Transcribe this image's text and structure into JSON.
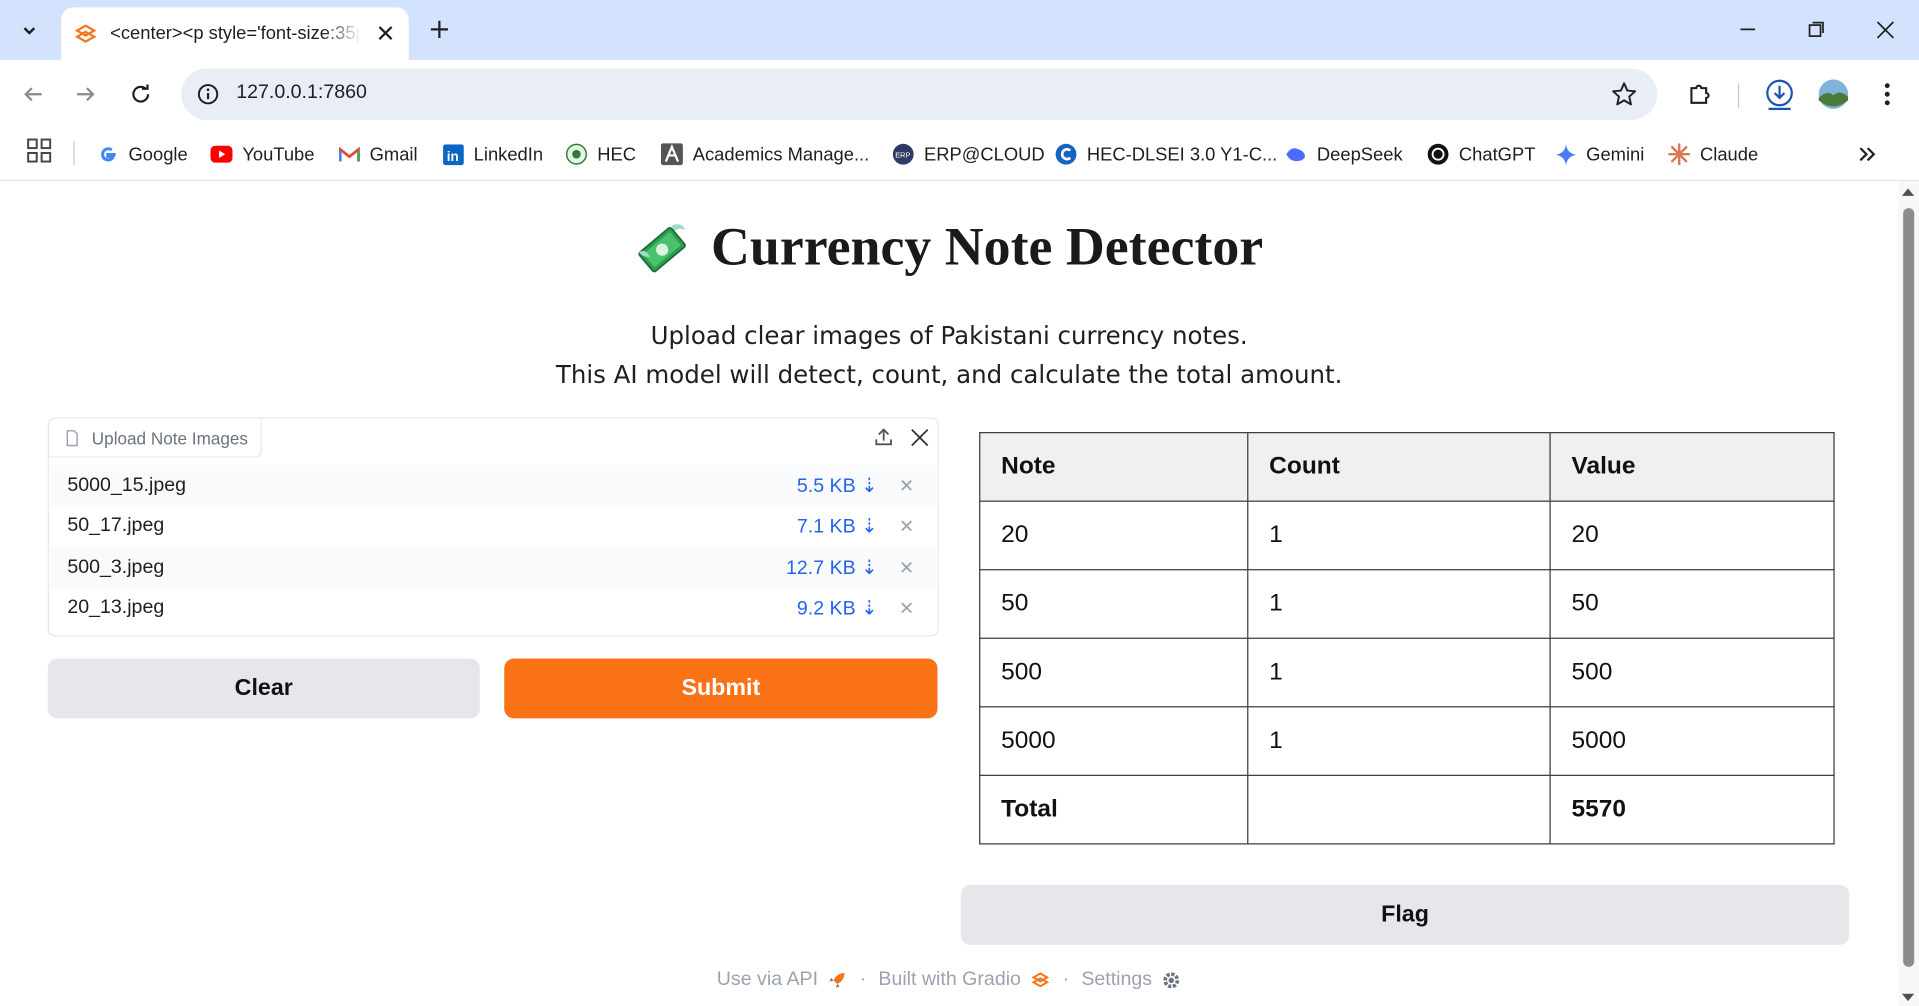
{
  "browser": {
    "tab_title": "<center><p style='font-size:35px",
    "url": "127.0.0.1:7860",
    "bookmarks": [
      {
        "label": "Google",
        "icon": "google-icon"
      },
      {
        "label": "YouTube",
        "icon": "youtube-icon"
      },
      {
        "label": "Gmail",
        "icon": "gmail-icon"
      },
      {
        "label": "LinkedIn",
        "icon": "linkedin-icon"
      },
      {
        "label": "HEC",
        "icon": "hec-icon"
      },
      {
        "label": "Academics Manage...",
        "icon": "academics-icon"
      },
      {
        "label": "ERP@CLOUD",
        "icon": "erp-icon"
      },
      {
        "label": "HEC-DLSEI 3.0 Y1-C...",
        "icon": "hec-dlsei-icon"
      },
      {
        "label": "DeepSeek",
        "icon": "deepseek-icon"
      },
      {
        "label": "ChatGPT",
        "icon": "chatgpt-icon"
      },
      {
        "label": "Gemini",
        "icon": "gemini-icon"
      },
      {
        "label": "Claude",
        "icon": "claude-icon"
      }
    ]
  },
  "app": {
    "title": "Currency Note Detector",
    "subtitle_line1": "Upload clear images of Pakistani currency notes.",
    "subtitle_line2": "This AI model will detect, count, and calculate the total amount.",
    "upload": {
      "label": "Upload Note Images",
      "files": [
        {
          "name": "5000_15.jpeg",
          "size": "5.5 KB ⇣"
        },
        {
          "name": "50_17.jpeg",
          "size": "7.1 KB ⇣"
        },
        {
          "name": "500_3.jpeg",
          "size": "12.7 KB ⇣"
        },
        {
          "name": "20_13.jpeg",
          "size": "9.2 KB ⇣"
        }
      ]
    },
    "buttons": {
      "clear": "Clear",
      "submit": "Submit",
      "flag": "Flag"
    },
    "table": {
      "headers": [
        "Note",
        "Count",
        "Value"
      ],
      "rows": [
        [
          "20",
          "1",
          "20"
        ],
        [
          "50",
          "1",
          "50"
        ],
        [
          "500",
          "1",
          "500"
        ],
        [
          "5000",
          "1",
          "5000"
        ]
      ],
      "total": {
        "label": "Total",
        "count": "",
        "value": "5570"
      }
    },
    "footer": {
      "api": "Use via API",
      "built": "Built with Gradio",
      "settings": "Settings"
    }
  },
  "colors": {
    "accent": "#f97316",
    "link": "#2563eb",
    "chrome_tabstrip": "#d3e3fd"
  }
}
